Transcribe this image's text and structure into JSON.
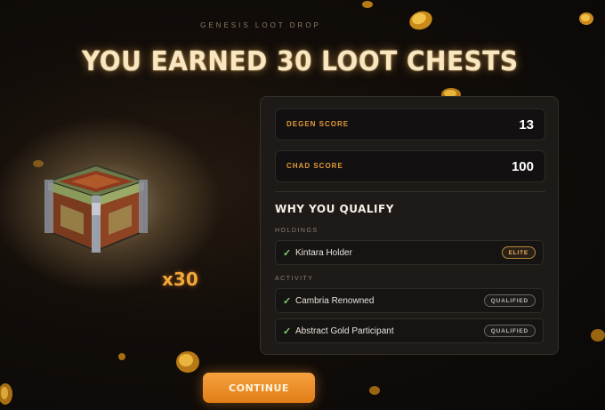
{
  "header": {
    "eyebrow": "GENESIS LOOT DROP",
    "headline": "YOU EARNED 30 LOOT CHESTS"
  },
  "reward": {
    "multiplier": "x30",
    "item_icon": "loot-chest-icon"
  },
  "scores": [
    {
      "label": "DEGEN SCORE",
      "value": "13"
    },
    {
      "label": "CHAD SCORE",
      "value": "100"
    }
  ],
  "qualify": {
    "title": "WHY YOU QUALIFY",
    "sections": [
      {
        "label": "HOLDINGS",
        "items": [
          {
            "label": "Kintara Holder",
            "badge": "ELITE"
          }
        ]
      },
      {
        "label": "ACTIVITY",
        "items": [
          {
            "label": "Cambria Renowned",
            "badge": "QUALIFIED"
          },
          {
            "label": "Abstract Gold Participant",
            "badge": "QUALIFIED"
          }
        ]
      }
    ]
  },
  "actions": {
    "continue_label": "CONTINUE"
  },
  "colors": {
    "accent": "#f39a2e",
    "check": "#7fd06a",
    "background": "#120d09"
  }
}
